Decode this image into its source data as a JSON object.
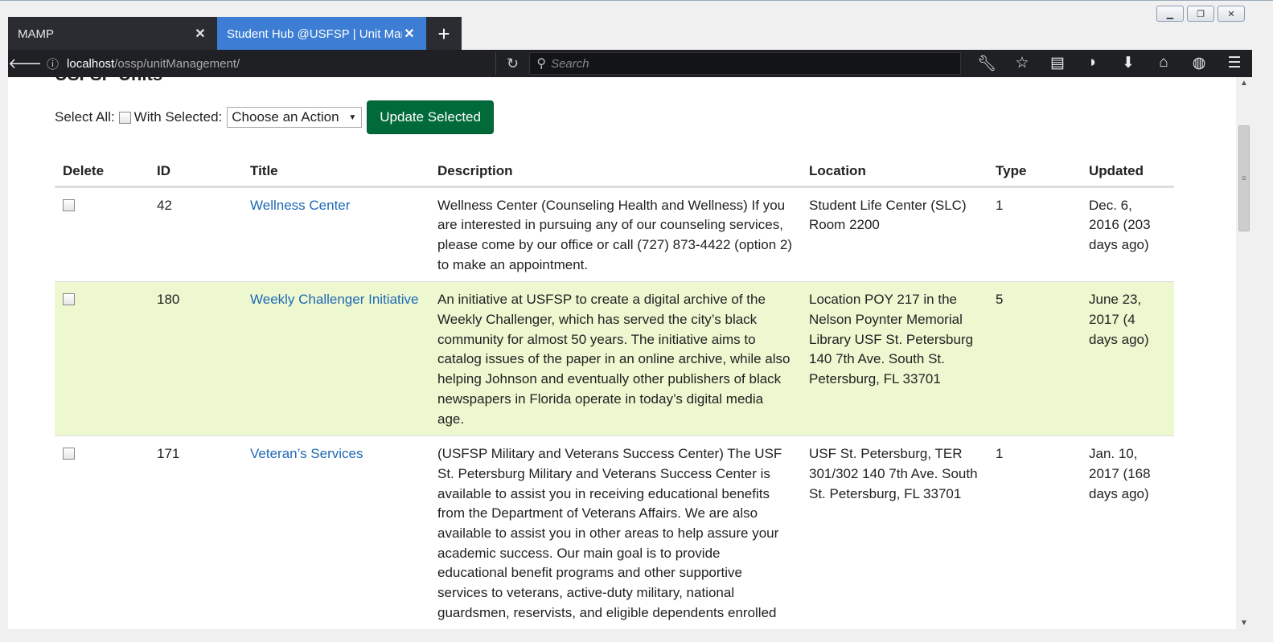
{
  "browser": {
    "tabs": [
      {
        "label": "MAMP",
        "active": false
      },
      {
        "label": "Student Hub @USFSP | Unit Management",
        "active": true
      }
    ],
    "url_host": "localhost",
    "url_path": "/ossp/unitManagement/",
    "search_placeholder": "Search"
  },
  "page": {
    "heading": "USFSP Units",
    "toolbar": {
      "select_all_label": "Select All:",
      "with_selected_label": "With Selected:",
      "action_select_value": "Choose an Action",
      "update_button": "Update Selected"
    },
    "table": {
      "headers": [
        "Delete",
        "ID",
        "Title",
        "Description",
        "Location",
        "Type",
        "Updated"
      ],
      "rows": [
        {
          "id": "42",
          "title": "Wellness Center",
          "description": "Wellness Center (Counseling Health and Wellness) If you are interested in pursuing any of our counseling services, please come by our office or call (727) 873-4422 (option 2) to make an appointment.",
          "location": "Student Life Center (SLC) Room 2200",
          "type": "1",
          "updated": "Dec. 6, 2016 (203 days ago)"
        },
        {
          "id": "180",
          "title": "Weekly Challenger Initiative",
          "description": "An initiative at USFSP to create a digital archive of the Weekly Challenger, which has served the city’s black community for almost 50 years. The initiative aims to catalog issues of the paper in an online archive, while also helping Johnson and eventually other publishers of black newspapers in Florida operate in today’s digital media age.",
          "location": "Location POY 217 in the Nelson Poynter Memorial Library USF St. Petersburg 140 7th Ave. South St. Petersburg, FL 33701",
          "type": "5",
          "updated": "June 23, 2017 (4 days ago)"
        },
        {
          "id": "171",
          "title": "Veteran’s Services",
          "description": "(USFSP Military and Veterans Success Center) The USF St. Petersburg Military and Veterans Success Center is available to assist you in receiving educational benefits from the Department of Veterans Affairs. We are also available to assist you in other areas to help assure your academic success. Our main goal is to provide educational benefit programs and other supportive services to veterans, active-duty military, national guardsmen, reservists, and eligible dependents enrolled",
          "location": "USF St. Petersburg, TER 301/302 140 7th Ave. South St. Petersburg, FL 33701",
          "type": "1",
          "updated": "Jan. 10, 2017 (168 days ago)"
        }
      ]
    }
  }
}
